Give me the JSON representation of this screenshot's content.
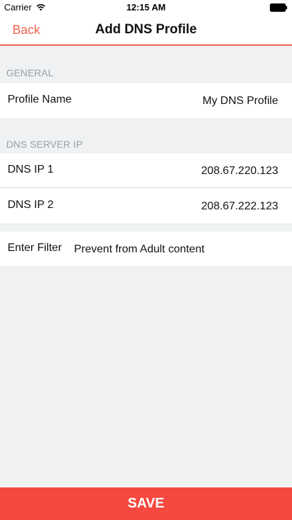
{
  "status_bar": {
    "carrier": "Carrier",
    "time": "12:15 AM"
  },
  "nav": {
    "back_label": "Back",
    "title": "Add DNS Profile"
  },
  "sections": {
    "general": {
      "header": "GENERAL",
      "profile_name_label": "Profile Name",
      "profile_name_value": "My DNS Profile"
    },
    "dns_server": {
      "header": "DNS SERVER IP",
      "dns1_label": "DNS IP 1",
      "dns1_value": "208.67.220.123",
      "dns2_label": "DNS IP 2",
      "dns2_value": "208.67.222.123"
    },
    "filter": {
      "label": "Enter Filter",
      "value": "Prevent from Adult content"
    }
  },
  "save_button": {
    "label": "SAVE"
  },
  "colors": {
    "accent": "#f0644f",
    "save_bg": "#f5493f",
    "background": "#eff1f2",
    "section_header": "#9a9fa3"
  },
  "icons": {
    "wifi": "wifi-icon",
    "battery": "battery-icon"
  }
}
